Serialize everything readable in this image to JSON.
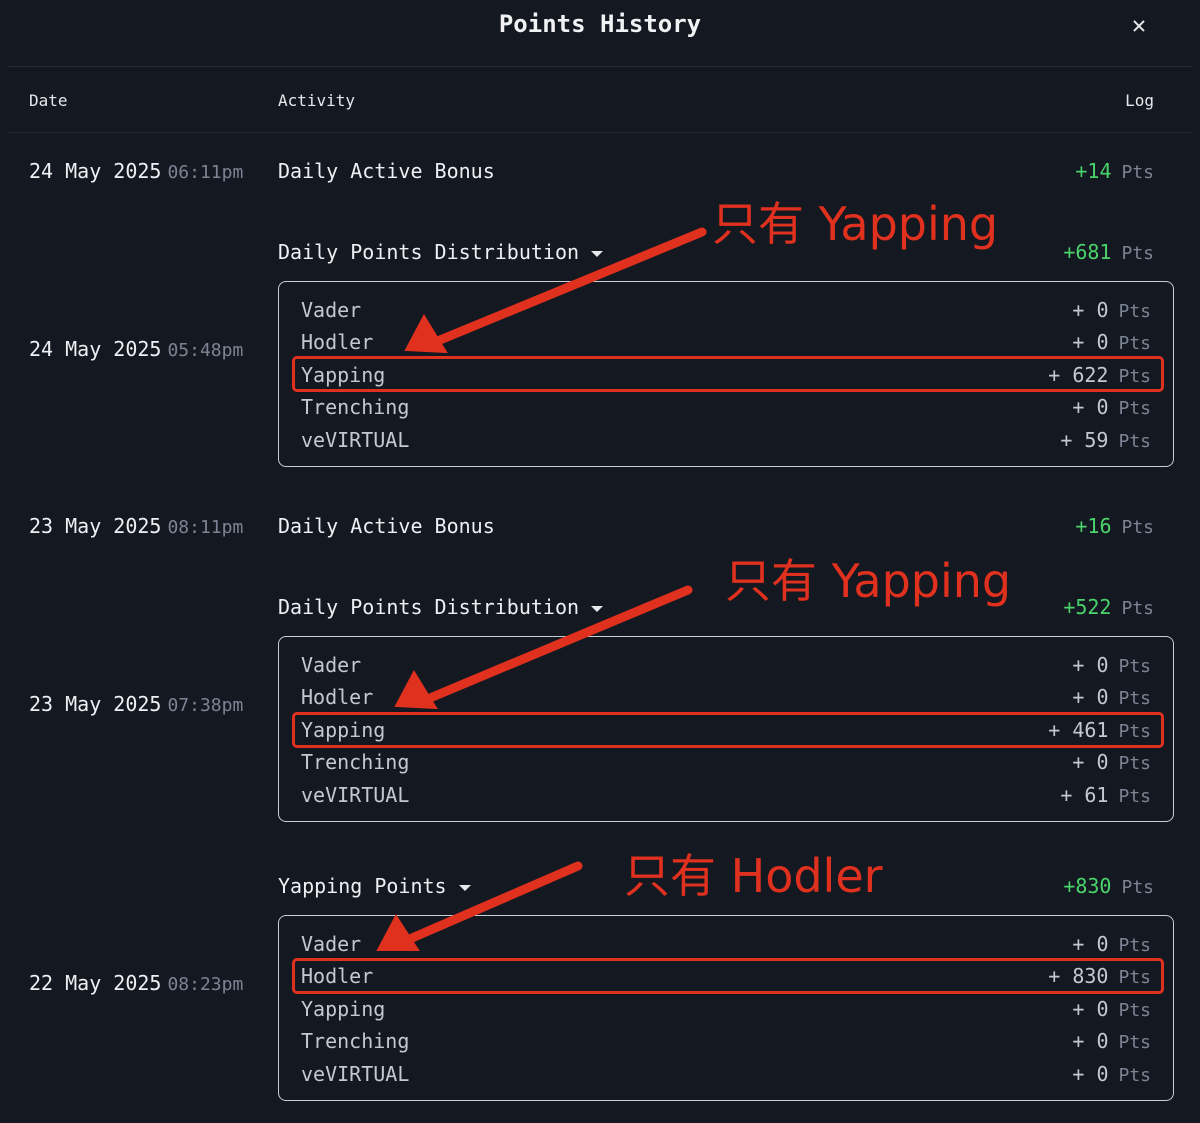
{
  "header": {
    "title": "Points History",
    "close_glyph": "✕"
  },
  "columns": {
    "date": "Date",
    "activity": "Activity",
    "log": "Log"
  },
  "unit": "Pts",
  "entries": [
    {
      "date": "24 May 2025",
      "time": "06:11pm",
      "activity": "Daily Active Bonus",
      "amount": "+14"
    },
    {
      "date": "24 May 2025",
      "time": "05:48pm",
      "activity": "Daily Points Distribution",
      "amount": "+681",
      "breakdown": [
        {
          "name": "Vader",
          "value": "+ 0"
        },
        {
          "name": "Hodler",
          "value": "+ 0"
        },
        {
          "name": "Yapping",
          "value": "+ 622"
        },
        {
          "name": "Trenching",
          "value": "+ 0"
        },
        {
          "name": "veVIRTUAL",
          "value": "+ 59"
        }
      ]
    },
    {
      "date": "23 May 2025",
      "time": "08:11pm",
      "activity": "Daily Active Bonus",
      "amount": "+16"
    },
    {
      "date": "23 May 2025",
      "time": "07:38pm",
      "activity": "Daily Points Distribution",
      "amount": "+522",
      "breakdown": [
        {
          "name": "Vader",
          "value": "+ 0"
        },
        {
          "name": "Hodler",
          "value": "+ 0"
        },
        {
          "name": "Yapping",
          "value": "+ 461"
        },
        {
          "name": "Trenching",
          "value": "+ 0"
        },
        {
          "name": "veVIRTUAL",
          "value": "+ 61"
        }
      ]
    },
    {
      "date": "22 May 2025",
      "time": "08:23pm",
      "activity": "Yapping Points",
      "amount": "+830",
      "breakdown": [
        {
          "name": "Vader",
          "value": "+ 0"
        },
        {
          "name": "Hodler",
          "value": "+ 830"
        },
        {
          "name": "Yapping",
          "value": "+ 0"
        },
        {
          "name": "Trenching",
          "value": "+ 0"
        },
        {
          "name": "veVIRTUAL",
          "value": "+ 0"
        }
      ]
    }
  ],
  "annotations": [
    "只有 Yapping",
    "只有 Yapping",
    "只有 Hodler"
  ],
  "colors": {
    "background": "#141821",
    "positive": "#4ad36b",
    "annotation": "#e0301e",
    "muted": "#7c8392"
  }
}
